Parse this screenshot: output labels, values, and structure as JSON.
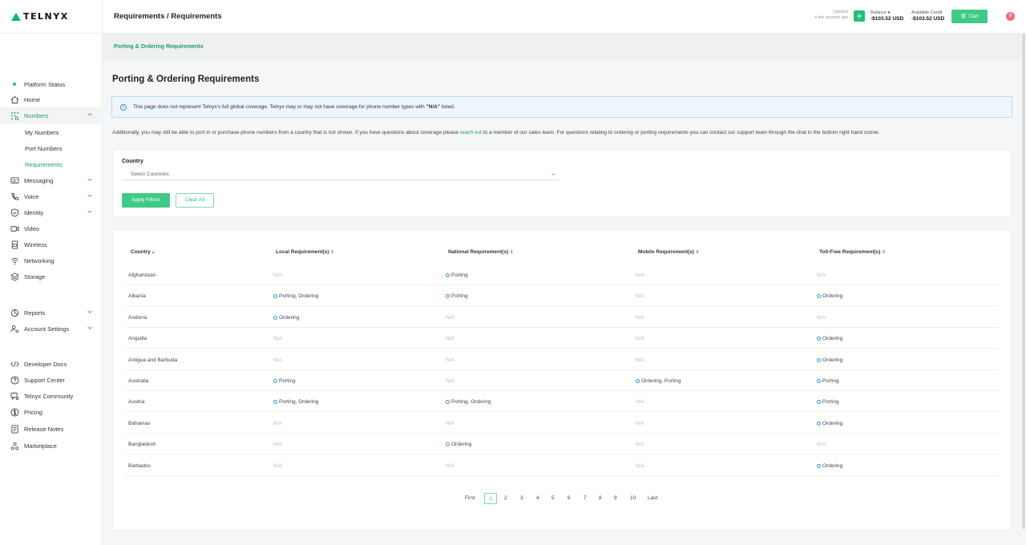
{
  "app": {
    "logo_text": "TELNYX"
  },
  "header": {
    "breadcrumb": "Requirements / Requirements",
    "updated_line1": "Updated",
    "updated_line2": "a few seconds ago",
    "balance_label": "Balance",
    "balance_value": "-$103.52 USD",
    "credit_label": "Available Credit",
    "credit_value": "-$103.52 USD",
    "cart_label": "Cart",
    "avatar_letter": "B",
    "plus_label": "+"
  },
  "sidebar": {
    "platform_status": "Platform Status",
    "items": [
      {
        "label": "Home",
        "icon": "home-icon"
      },
      {
        "label": "Numbers",
        "icon": "numbers-icon"
      },
      {
        "label": "My Numbers"
      },
      {
        "label": "Port Numbers"
      },
      {
        "label": "Requirements"
      },
      {
        "label": "Messaging",
        "icon": "messaging-icon"
      },
      {
        "label": "Voice",
        "icon": "voice-icon"
      },
      {
        "label": "Identity",
        "icon": "identity-icon"
      },
      {
        "label": "Video",
        "icon": "video-icon"
      },
      {
        "label": "Wireless",
        "icon": "wireless-icon"
      },
      {
        "label": "Networking",
        "icon": "networking-icon"
      },
      {
        "label": "Storage",
        "icon": "storage-icon"
      },
      {
        "label": "Reports",
        "icon": "reports-icon"
      },
      {
        "label": "Account Settings",
        "icon": "account-settings-icon"
      },
      {
        "label": "Developer Docs",
        "icon": "code-icon"
      },
      {
        "label": "Support Center",
        "icon": "help-icon"
      },
      {
        "label": "Telnyx Community",
        "icon": "community-icon"
      },
      {
        "label": "Pricing",
        "icon": "pricing-icon"
      },
      {
        "label": "Release Notes",
        "icon": "release-notes-icon"
      },
      {
        "label": "Marketplace",
        "icon": "marketplace-icon"
      }
    ]
  },
  "subnav": {
    "label": "Porting & Ordering Requirements"
  },
  "main": {
    "title": "Porting & Ordering Requirements",
    "notice_pre": "This page does not represent Telnyx's full global coverage. Telnyx may or may not have coverage for phone number types with ",
    "notice_bold": "\"N/A\"",
    "notice_post": " listed.",
    "addl_pre": "Additionally, you may still be able to port in or purchase phone numbers from a country that is not shown. If you have questions about coverage please ",
    "addl_link": "reach out",
    "addl_post": " to a member of our sales team. For questions relating to ordering or porting requirements you can contact our support team through the chat in the bottom right hand corner."
  },
  "filters": {
    "country_label": "Country",
    "country_placeholder": "Select Countries",
    "apply_label": "Apply Filters",
    "clear_label": "Clear All"
  },
  "table": {
    "columns": [
      "Country",
      "Local Requirement(s)",
      "National Requirement(s)",
      "Mobile Requirement(s)",
      "Toll-Free Requirement(s)"
    ],
    "rows": [
      [
        "Afghanistan",
        "N/A",
        "Porting",
        "N/A",
        "N/A"
      ],
      [
        "Albania",
        "Porting, Ordering",
        "Porting",
        "N/A",
        "Ordering"
      ],
      [
        "Andorra",
        "Ordering",
        "N/A",
        "N/A",
        "N/A"
      ],
      [
        "Anguilla",
        "N/A",
        "N/A",
        "N/A",
        "Ordering"
      ],
      [
        "Antigua and Barbuda",
        "N/A",
        "N/A",
        "N/A",
        "Ordering"
      ],
      [
        "Australia",
        "Porting",
        "N/A",
        "Ordering, Porting",
        "Porting"
      ],
      [
        "Austria",
        "Porting, Ordering",
        "Porting, Ordering",
        "N/A",
        "Porting"
      ],
      [
        "Bahamas",
        "N/A",
        "N/A",
        "N/A",
        "Ordering"
      ],
      [
        "Bangladesh",
        "N/A",
        "Ordering",
        "N/A",
        "N/A"
      ],
      [
        "Barbados",
        "N/A",
        "N/A",
        "N/A",
        "Ordering"
      ]
    ]
  },
  "pagination": {
    "first": "First",
    "pages": [
      "1",
      "2",
      "3",
      "4",
      "5",
      "6",
      "7",
      "8",
      "9",
      "10"
    ],
    "last": "Last",
    "current": "1"
  }
}
